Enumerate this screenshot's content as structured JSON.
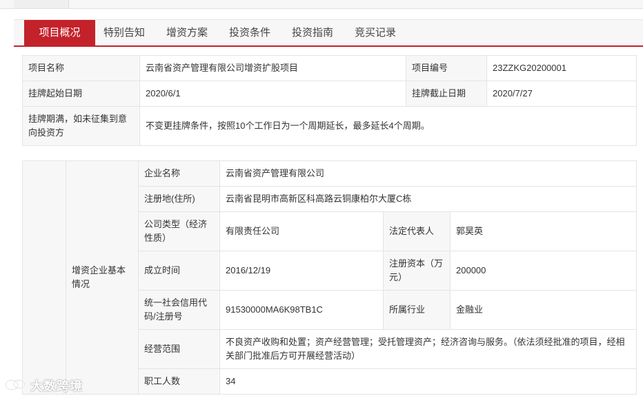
{
  "tabs": [
    {
      "label": "项目概况",
      "active": true
    },
    {
      "label": "特别告知",
      "active": false
    },
    {
      "label": "增资方案",
      "active": false
    },
    {
      "label": "投资条件",
      "active": false
    },
    {
      "label": "投资指南",
      "active": false
    },
    {
      "label": "竞买记录",
      "active": false
    }
  ],
  "project": {
    "name_label": "项目名称",
    "name_value": "云南省资产管理有限公司增资扩股项目",
    "code_label": "项目编号",
    "code_value": "23ZZKG20200001",
    "start_label": "挂牌起始日期",
    "start_value": "2020/6/1",
    "end_label": "挂牌截止日期",
    "end_value": "2020/7/27",
    "expiry_label": "挂牌期满，如未征集到意向投资方",
    "expiry_value": "不变更挂牌条件，按照10个工作日为一个周期延长，最多延长4个周期。"
  },
  "company": {
    "section_label": "增资企业基本情况",
    "name_label": "企业名称",
    "name_value": "云南省资产管理有限公司",
    "address_label": "注册地(住所)",
    "address_value": "云南省昆明市高新区科高路云铜康柏尔大厦C栋",
    "type_label": "公司类型（经济性质）",
    "type_value": "有限责任公司",
    "legal_rep_label": "法定代表人",
    "legal_rep_value": "郭昊英",
    "founded_label": "成立时间",
    "founded_value": "2016/12/19",
    "capital_label": "注册资本（万元）",
    "capital_value": "200000",
    "credit_code_label": "统一社会信用代码/注册号",
    "credit_code_value": "91530000MA6K98TB1C",
    "industry_label": "所属行业",
    "industry_value": "金融业",
    "scope_label": "经营范围",
    "scope_value": "不良资产收购和处置；资产经营管理；受托管理资产；经济咨询与服务。（依法须经批准的项目，经相关部门批准后方可开展经营活动）",
    "employees_label": "职工人数",
    "employees_value": "34"
  },
  "watermark": {
    "text": "大数跨境",
    "icon": "chat-bubble-logo-icon"
  },
  "colors": {
    "accent": "#c3222b",
    "label_bg": "#f7f7f7",
    "border": "#e4e4e4"
  }
}
